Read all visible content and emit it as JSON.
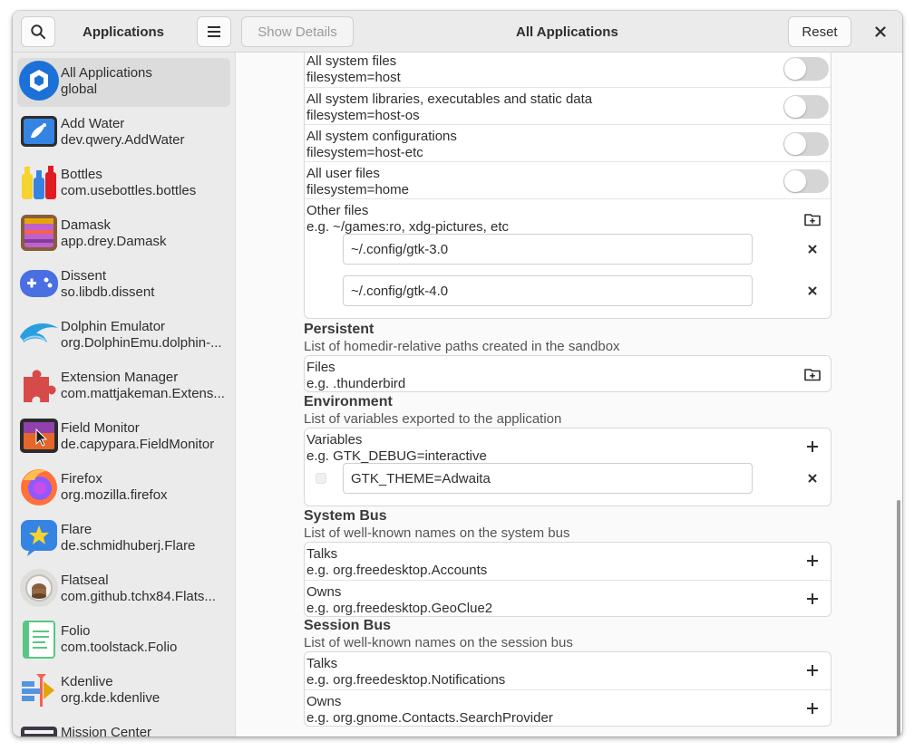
{
  "window": {
    "app_title": "Applications",
    "page_title": "All Applications",
    "show_details_label": "Show Details",
    "reset_label": "Reset",
    "close_glyph": "✕"
  },
  "icons": {
    "search": "search-icon",
    "menu": "hamburger-menu-icon",
    "folder_add": "folder-new-icon",
    "plus": "plus-icon",
    "remove": "close-icon"
  },
  "sidebar": {
    "items": [
      {
        "name": "All Applications",
        "id": "global",
        "selected": true,
        "icon": "all-apps-icon",
        "color": "#1c71d8"
      },
      {
        "name": "Add Water",
        "id": "dev.qwery.AddWater",
        "icon": "add-water-icon",
        "color": "#3584e4"
      },
      {
        "name": "Bottles",
        "id": "com.usebottles.bottles",
        "icon": "bottles-icon",
        "color": "#e66100"
      },
      {
        "name": "Damask",
        "id": "app.drey.Damask",
        "icon": "damask-icon",
        "color": "#865e3c"
      },
      {
        "name": "Dissent",
        "id": "so.libdb.dissent",
        "icon": "dissent-icon",
        "color": "#4a6fe3"
      },
      {
        "name": "Dolphin Emulator",
        "id": "org.DolphinEmu.dolphin-...",
        "icon": "dolphin-icon",
        "color": "#2a9fe0"
      },
      {
        "name": "Extension Manager",
        "id": "com.mattjakeman.Extens...",
        "icon": "puzzle-icon",
        "color": "#d74a4a"
      },
      {
        "name": "Field Monitor",
        "id": "de.capypara.FieldMonitor",
        "icon": "field-monitor-icon",
        "color": "#e5662a"
      },
      {
        "name": "Firefox",
        "id": "org.mozilla.firefox",
        "icon": "firefox-icon",
        "color": "#ff7139"
      },
      {
        "name": "Flare",
        "id": "de.schmidhuberj.Flare",
        "icon": "flare-icon",
        "color": "#3584e4"
      },
      {
        "name": "Flatseal",
        "id": "com.github.tchx84.Flats...",
        "icon": "flatseal-icon",
        "color": "#deddda"
      },
      {
        "name": "Folio",
        "id": "com.toolstack.Folio",
        "icon": "folio-icon",
        "color": "#57c785"
      },
      {
        "name": "Kdenlive",
        "id": "org.kde.kdenlive",
        "icon": "kdenlive-icon",
        "color": "#5294e2"
      },
      {
        "name": "Mission Center",
        "id": "",
        "icon": "mission-center-icon",
        "color": "#3d3846"
      }
    ]
  },
  "filesystem": {
    "rows": [
      {
        "title": "All system files",
        "subtitle": "filesystem=host",
        "enabled": false
      },
      {
        "title": "All system libraries, executables and static data",
        "subtitle": "filesystem=host-os",
        "enabled": false
      },
      {
        "title": "All system configurations",
        "subtitle": "filesystem=host-etc",
        "enabled": false
      },
      {
        "title": "All user files",
        "subtitle": "filesystem=home",
        "enabled": false
      }
    ],
    "other_title": "Other files",
    "other_subtitle": "e.g. ~/games:ro, xdg-pictures, etc",
    "other_values": [
      "~/.config/gtk-3.0",
      "~/.config/gtk-4.0"
    ]
  },
  "persistent": {
    "title": "Persistent",
    "description": "List of homedir-relative paths created in the sandbox",
    "row_title": "Files",
    "row_subtitle": "e.g. .thunderbird"
  },
  "environment": {
    "title": "Environment",
    "description": "List of variables exported to the application",
    "row_title": "Variables",
    "row_subtitle": "e.g. GTK_DEBUG=interactive",
    "values": [
      "GTK_THEME=Adwaita"
    ]
  },
  "system_bus": {
    "title": "System Bus",
    "description": "List of well-known names on the system bus",
    "talks_title": "Talks",
    "talks_subtitle": "e.g. org.freedesktop.Accounts",
    "owns_title": "Owns",
    "owns_subtitle": "e.g. org.freedesktop.GeoClue2"
  },
  "session_bus": {
    "title": "Session Bus",
    "description": "List of well-known names on the session bus",
    "talks_title": "Talks",
    "talks_subtitle": "e.g. org.freedesktop.Notifications",
    "owns_title": "Owns",
    "owns_subtitle": "e.g. org.gnome.Contacts.SearchProvider"
  }
}
